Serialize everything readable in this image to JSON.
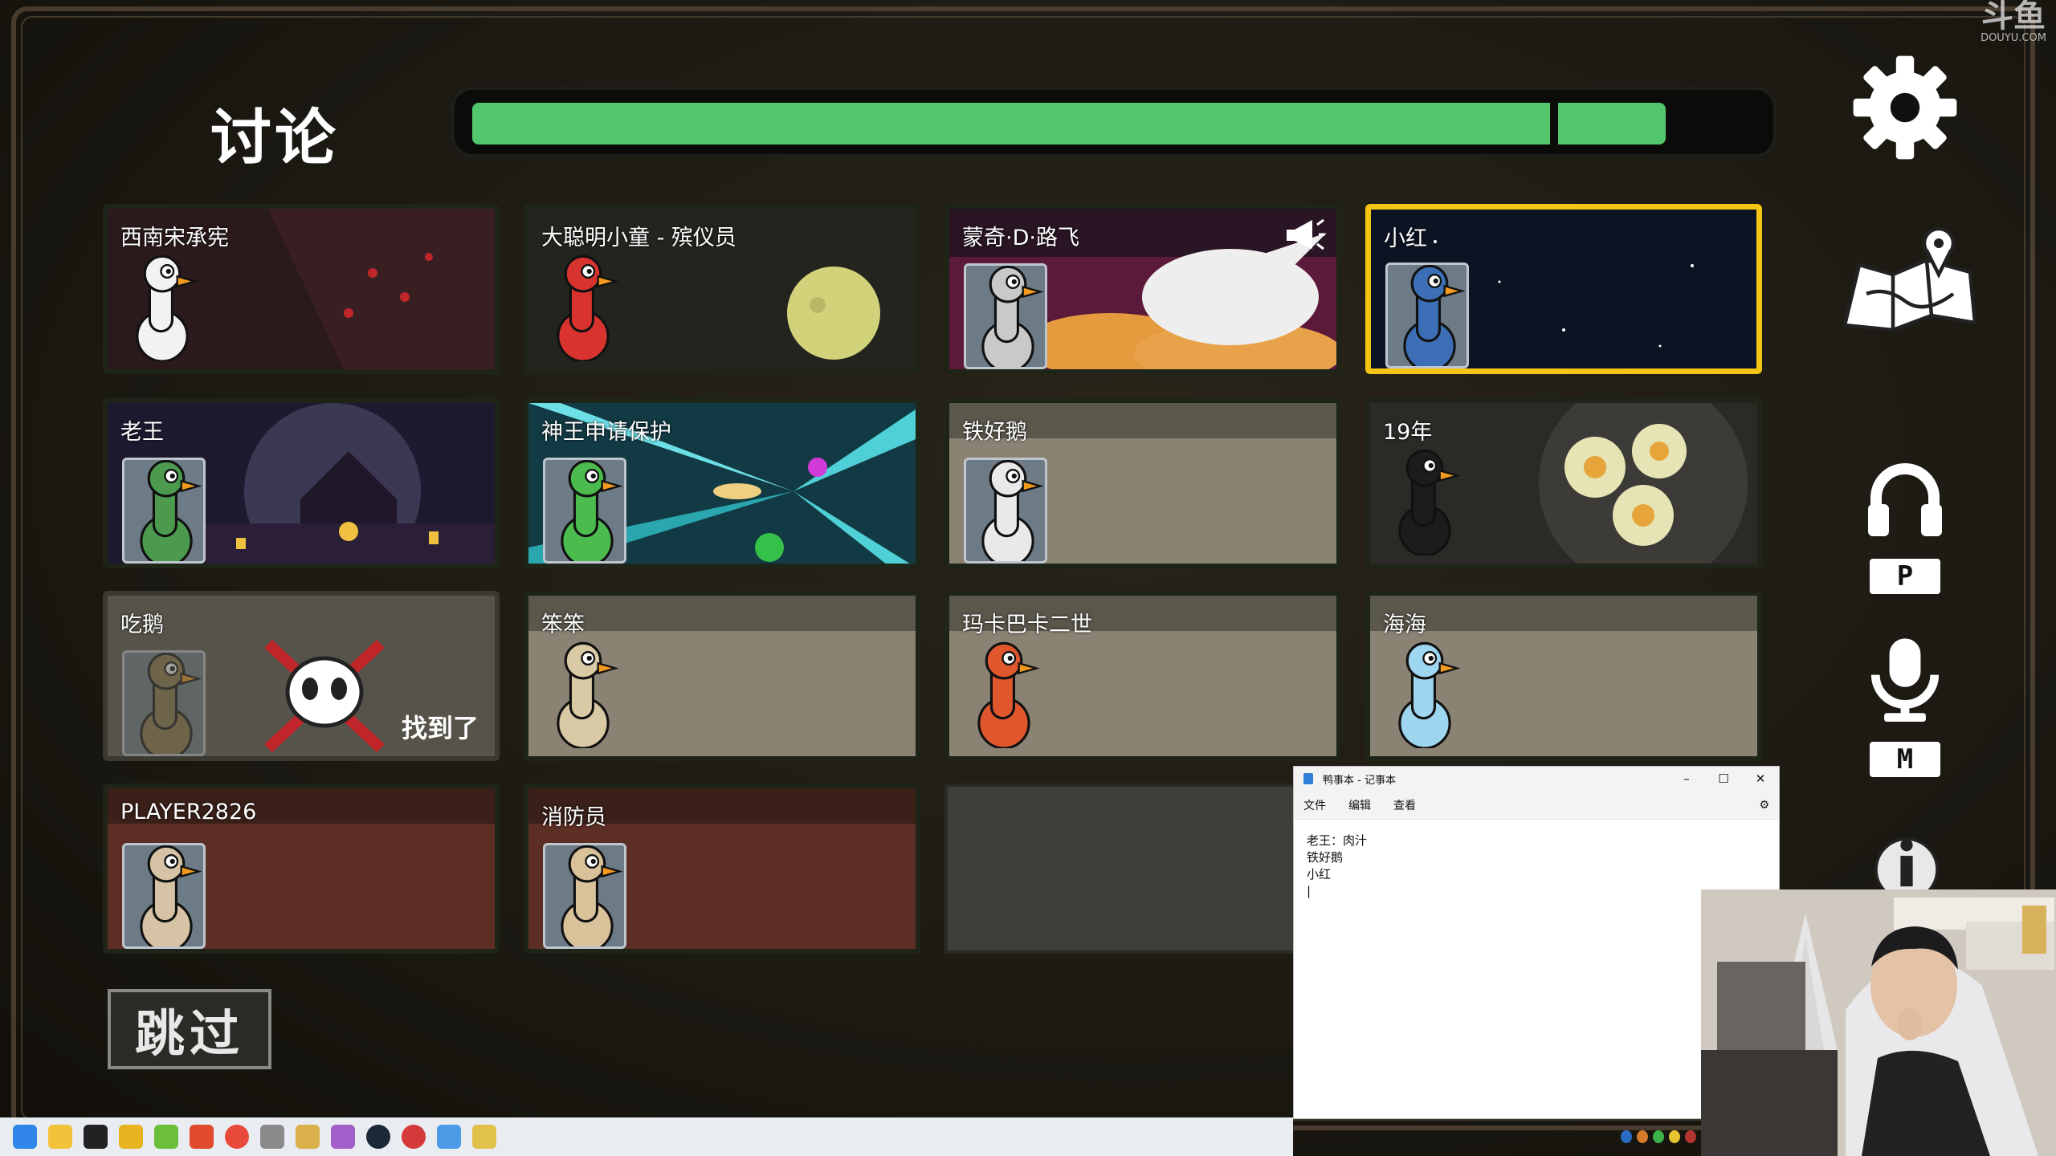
{
  "phase": {
    "title": "讨论",
    "timer_progress": 0.93
  },
  "players": [
    {
      "name": "西南宋承宪",
      "state": "alive",
      "scene": "red-room",
      "avatar": "white-rabbit-goose"
    },
    {
      "name": "大聪明小童 - 殡仪员",
      "state": "alive",
      "scene": "moon",
      "avatar": "red-goose"
    },
    {
      "name": "蒙奇·D·路飞",
      "state": "alive",
      "scene": "rabbit-clouds",
      "avatar": "card-goose",
      "speaking": true
    },
    {
      "name": "小红",
      "state": "selected",
      "scene": "starfield",
      "avatar": "card-ace-goose"
    },
    {
      "name": "老王",
      "state": "alive",
      "scene": "night-house",
      "avatar": "green-goose"
    },
    {
      "name": "神王申请保护",
      "state": "alive",
      "scene": "warp",
      "avatar": "dino-goose"
    },
    {
      "name": "铁好鹅",
      "state": "alive",
      "scene": "plain",
      "avatar": "white-goose"
    },
    {
      "name": "19年",
      "state": "alive",
      "scene": "eggs-pan",
      "avatar": "black-goose"
    },
    {
      "name": "吃鹅",
      "state": "dead",
      "scene": "dead",
      "avatar": "faded-goose",
      "status_label": "找到了"
    },
    {
      "name": "笨笨",
      "state": "alive",
      "scene": "plain",
      "avatar": "sunglasses-goose"
    },
    {
      "name": "玛卡巴卡二世",
      "state": "alive",
      "scene": "plain",
      "avatar": "orange-goose"
    },
    {
      "name": "海海",
      "state": "alive",
      "scene": "plain",
      "avatar": "flower-goose"
    },
    {
      "name": "PLAYER2826",
      "state": "alive",
      "scene": "rust",
      "avatar": "plain-goose"
    },
    {
      "name": "消防员",
      "state": "alive",
      "scene": "rust",
      "avatar": "mummy-goose"
    }
  ],
  "skip_label": "跳过",
  "side_controls": {
    "settings_icon": "gear-icon",
    "map_icon": "map-icon",
    "voice_key": "P",
    "mic_key": "M",
    "info_icon": "info-icon"
  },
  "watermark": {
    "brand": "斗鱼",
    "site": "DOUYU.COM"
  },
  "notepad": {
    "title": "鸭事本 - 记事本",
    "menu": [
      "文件",
      "编辑",
      "查看"
    ],
    "lines": "老王：肉汁\n铁好鹅\n小红\n|"
  },
  "colors": {
    "timer": "#52c76d",
    "selected": "#f5c514"
  }
}
